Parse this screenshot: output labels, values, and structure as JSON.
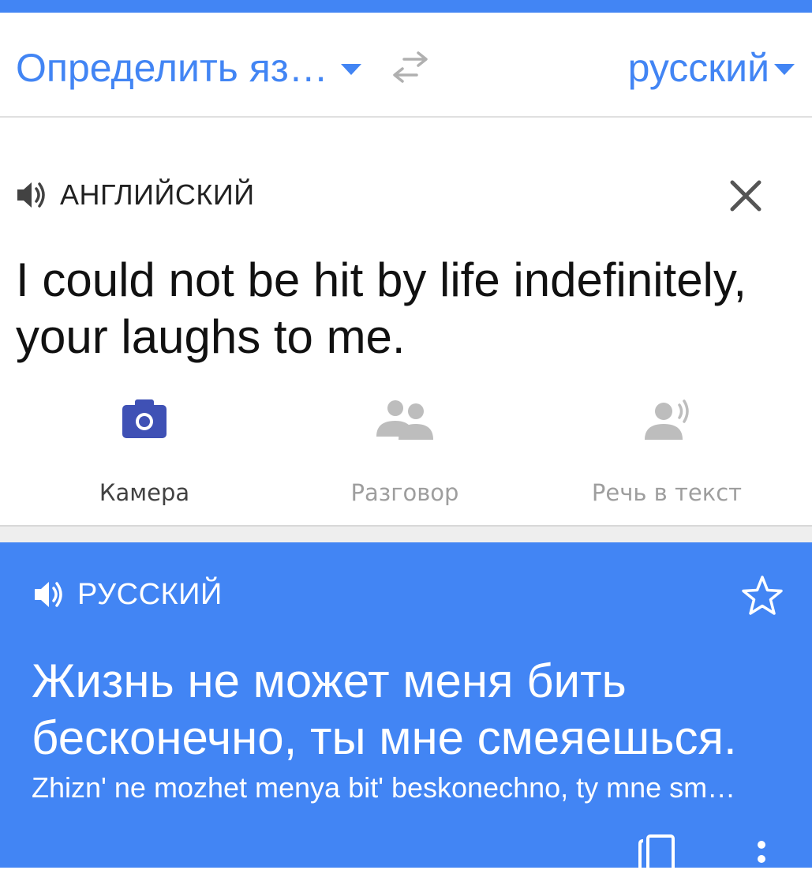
{
  "header": {
    "source_language": "Определить яз…",
    "target_language": "русский"
  },
  "input": {
    "language_label": "АНГЛИЙСКИЙ",
    "text": "I could not be hit by life indefinitely, your laughs to me."
  },
  "tools": [
    {
      "label": "Камера",
      "icon": "camera-icon",
      "active": true
    },
    {
      "label": "Разговор",
      "icon": "conversation-icon",
      "active": false
    },
    {
      "label": "Речь в текст",
      "icon": "speech-to-text-icon",
      "active": false
    }
  ],
  "result": {
    "language_label": "РУССКИЙ",
    "text": "Жизнь не может меня бить бесконечно, ты мне смеяешься.",
    "transliteration": "Zhizn' ne mozhet menya bit' beskonechno, ty mne sm…"
  },
  "colors": {
    "accent": "#4285f4",
    "camera_active": "#3f51b5",
    "inactive": "#9e9e9e"
  }
}
